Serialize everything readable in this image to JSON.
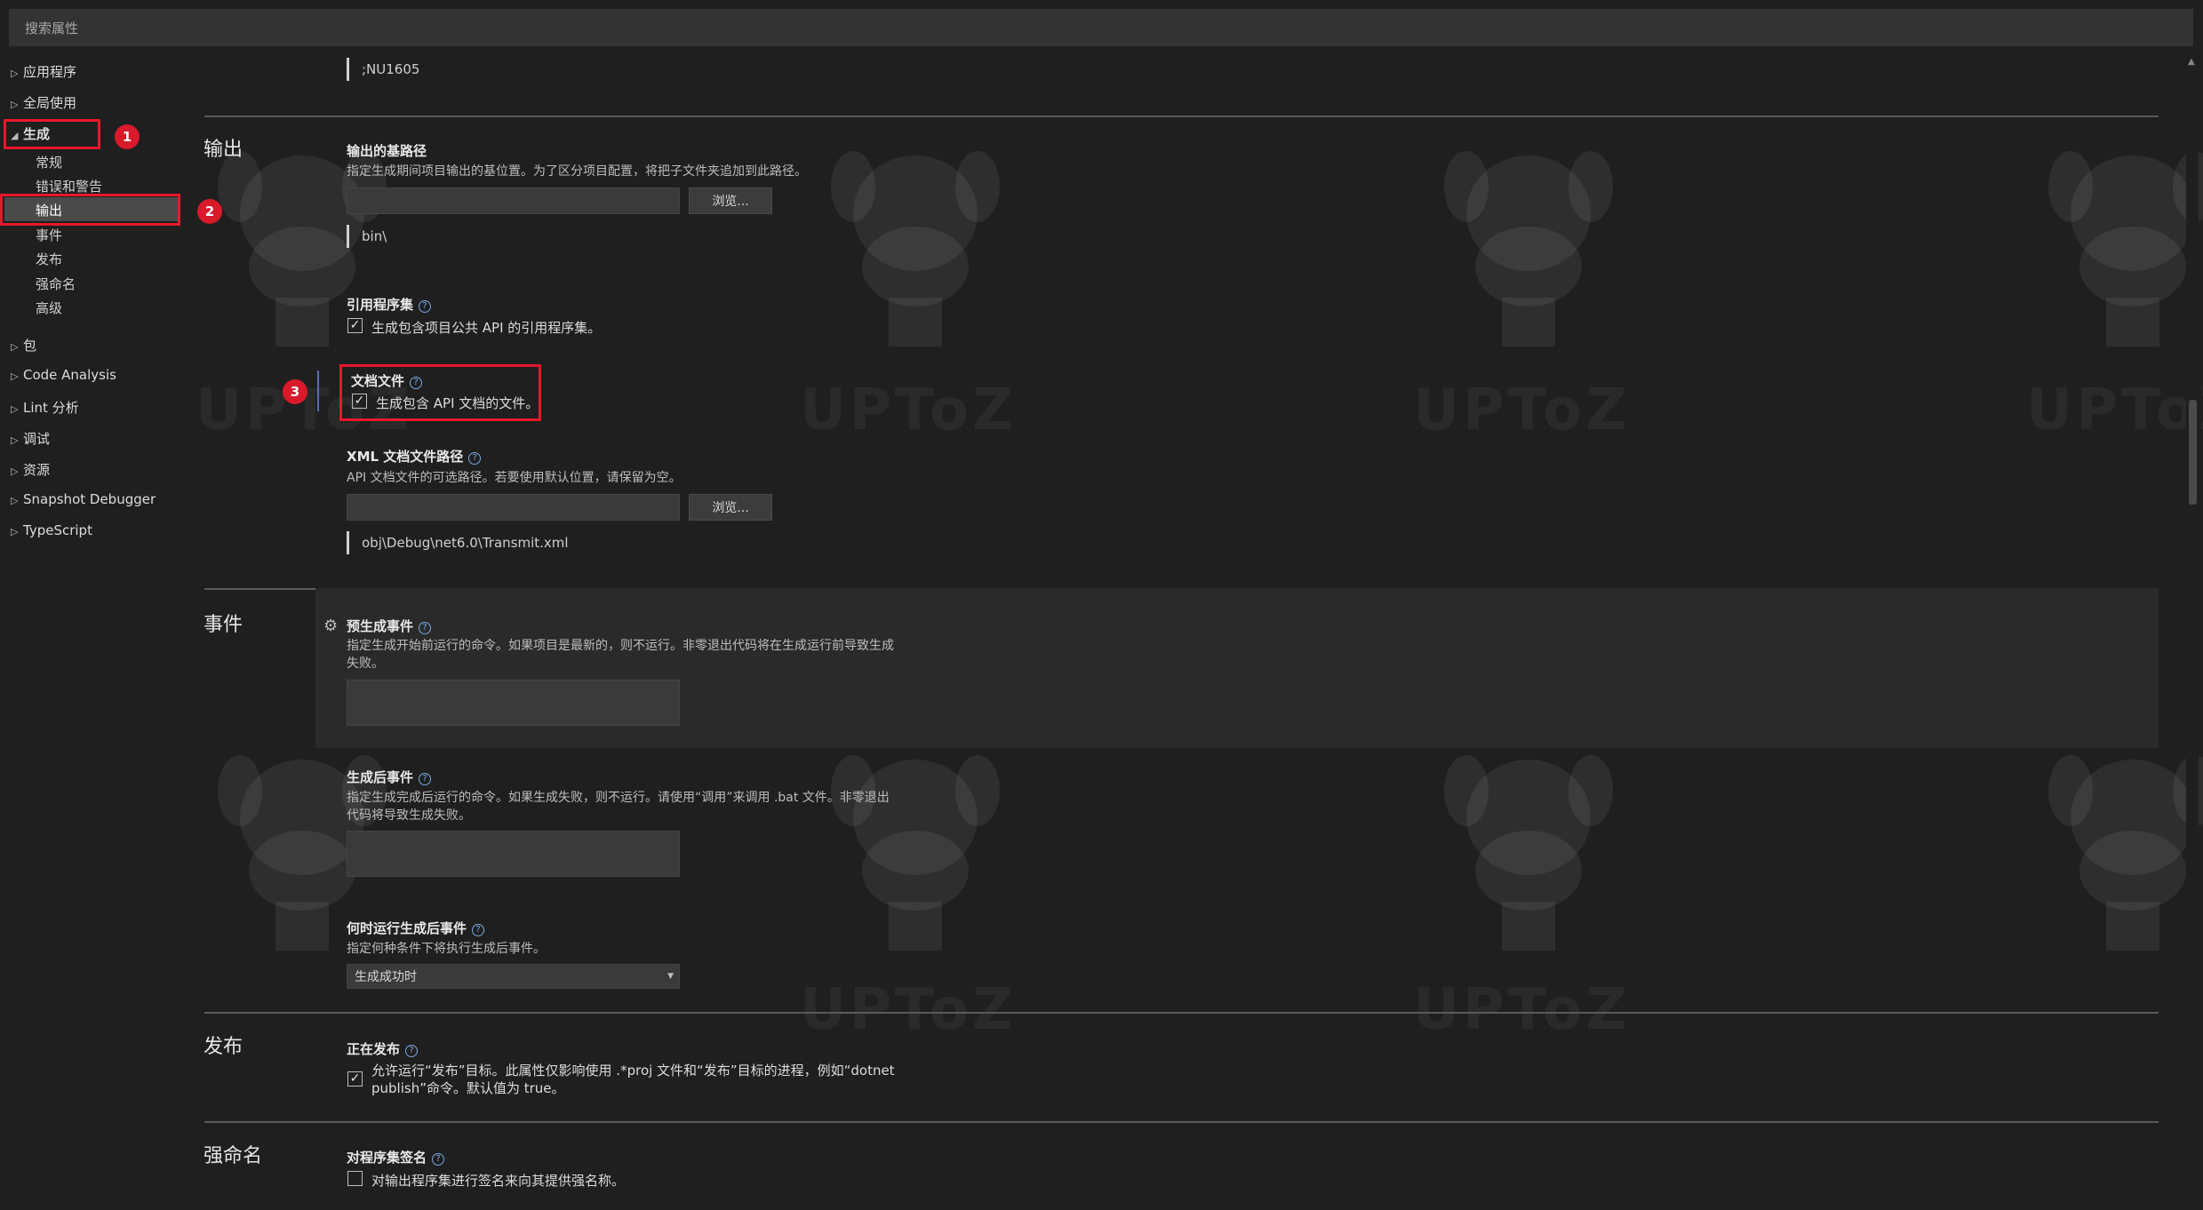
{
  "search": {
    "placeholder": "搜索属性"
  },
  "sidebar": {
    "groups": [
      {
        "label": "应用程序"
      },
      {
        "label": "全局使用"
      },
      {
        "label": "生成"
      },
      {
        "label": "包"
      },
      {
        "label": "Code Analysis"
      },
      {
        "label": "Lint 分析"
      },
      {
        "label": "调试"
      },
      {
        "label": "资源"
      },
      {
        "label": "Snapshot Debugger"
      },
      {
        "label": "TypeScript"
      }
    ],
    "build_children": [
      {
        "label": "常规"
      },
      {
        "label": "错误和警告"
      },
      {
        "label": "输出"
      },
      {
        "label": "事件"
      },
      {
        "label": "发布"
      },
      {
        "label": "强命名"
      },
      {
        "label": "高级"
      }
    ],
    "selected": "输出"
  },
  "annotations": {
    "badge1": "1",
    "badge2": "2",
    "badge3": "3"
  },
  "content": {
    "top_value": ";NU1605",
    "output": {
      "title": "输出",
      "base_path": {
        "label": "输出的基路径",
        "description": "指定生成期间项目输出的基位置。为了区分项目配置，将把子文件夹追加到此路径。",
        "browse": "浏览...",
        "value": "bin\\"
      },
      "ref_assembly": {
        "label": "引用程序集",
        "checkbox_label": "生成包含项目公共 API 的引用程序集。",
        "checked": true
      },
      "doc_file": {
        "label": "文档文件",
        "checkbox_label": "生成包含 API 文档的文件。",
        "checked": true
      },
      "xml_doc_path": {
        "label": "XML 文档文件路径",
        "description": "API 文档文件的可选路径。若要使用默认位置，请保留为空。",
        "browse": "浏览...",
        "value": "obj\\Debug\\net6.0\\Transmit.xml"
      }
    },
    "events": {
      "title": "事件",
      "pre_build": {
        "label": "预生成事件",
        "description": "指定生成开始前运行的命令。如果项目是最新的，则不运行。非零退出代码将在生成运行前导致生成失败。"
      },
      "post_build": {
        "label": "生成后事件",
        "description": "指定生成完成后运行的命令。如果生成失败，则不运行。请使用“调用”来调用 .bat 文件。非零退出代码将导致生成失败。"
      },
      "when_run": {
        "label": "何时运行生成后事件",
        "description": "指定何种条件下将执行生成后事件。",
        "selected": "生成成功时"
      }
    },
    "publish": {
      "title": "发布",
      "publishing": {
        "label": "正在发布",
        "checkbox_label": "允许运行“发布”目标。此属性仅影响使用 .*proj 文件和“发布”目标的进程，例如“dotnet publish”命令。默认值为 true。",
        "checked": true
      }
    },
    "strong_name": {
      "title": "强命名",
      "sign": {
        "label": "对程序集签名",
        "checkbox_label": "对输出程序集进行签名来向其提供强名称。",
        "checked": false
      }
    }
  },
  "watermark": {
    "text": "UPToZ"
  }
}
